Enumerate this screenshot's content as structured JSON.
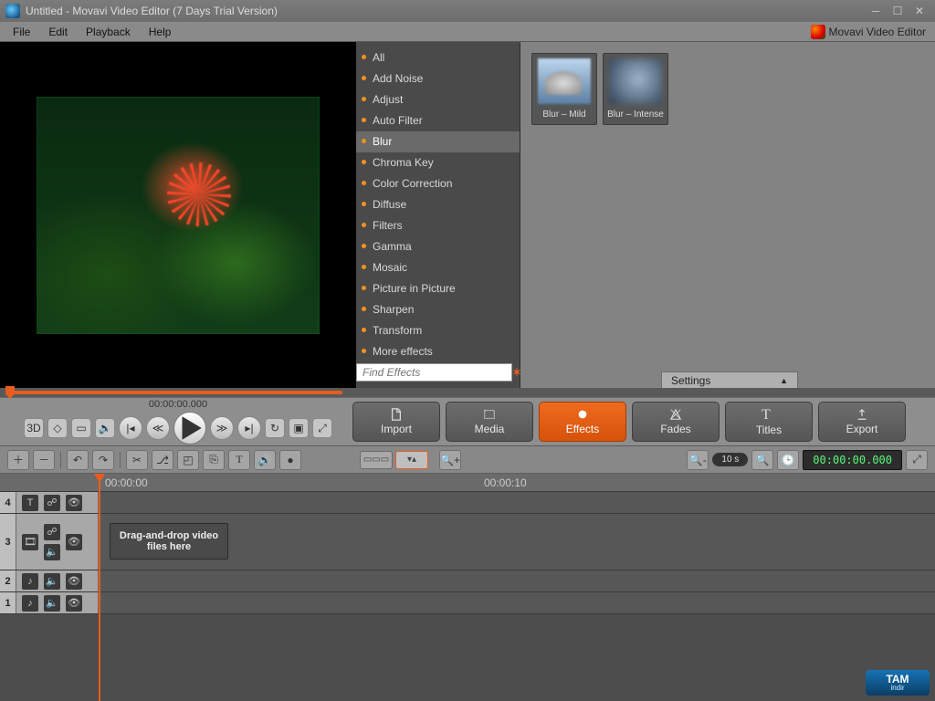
{
  "window": {
    "title": "Untitled - Movavi Video Editor (7 Days Trial Version)"
  },
  "menu": {
    "file": "File",
    "edit": "Edit",
    "playback": "Playback",
    "help": "Help",
    "brand": "Movavi Video Editor"
  },
  "effects_categories": [
    "All",
    "Add Noise",
    "Adjust",
    "Auto Filter",
    "Blur",
    "Chroma Key",
    "Color Correction",
    "Diffuse",
    "Filters",
    "Gamma",
    "Mosaic",
    "Picture in Picture",
    "Sharpen",
    "Transform",
    "More effects"
  ],
  "effects_selected_index": 4,
  "find_effects": {
    "placeholder": "Find Effects"
  },
  "presets": [
    {
      "label": "Blur – Mild",
      "variant": "mild"
    },
    {
      "label": "Blur – Intense",
      "variant": "intense"
    }
  ],
  "settings_tab": "Settings",
  "playback_time": "00:00:00.000",
  "tabs": {
    "import": "Import",
    "media": "Media",
    "effects": "Effects",
    "fades": "Fades",
    "titles": "Titles",
    "export": "Export"
  },
  "zoom_label": "10 s",
  "timeline_time": "00:00:00.000",
  "ruler": {
    "t0": "00:00:00",
    "t1": "00:00:10"
  },
  "tracks": {
    "t4": "4",
    "t3": "3",
    "t2": "2",
    "t1": "1"
  },
  "drop_hint": "Drag-and-drop video files here",
  "watermark": {
    "big": "TAM",
    "small": "indir"
  }
}
